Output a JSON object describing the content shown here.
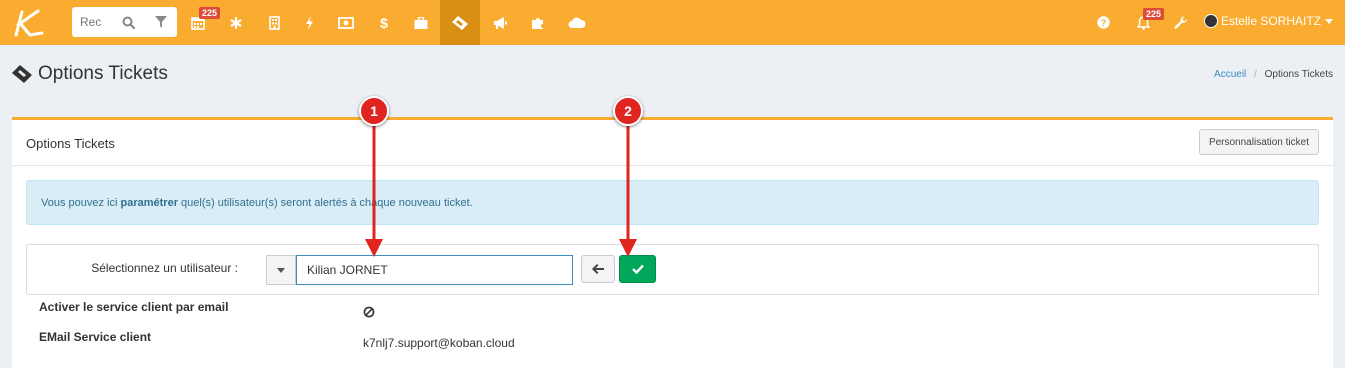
{
  "topbar": {
    "search_placeholder": "Rec",
    "calendar_badge": "225",
    "notif_badge": "225",
    "user_name": "Estelle SORHAITZ",
    "icons": [
      "calendar-icon",
      "asterisk-icon",
      "building-icon",
      "bolt-icon",
      "money-icon",
      "dollar-icon",
      "briefcase-icon",
      "ticket-icon",
      "bullhorn-icon",
      "puzzle-icon",
      "cloud-icon",
      "help-icon",
      "bell-icon",
      "wrench-icon"
    ],
    "accent": "#f9ac2f"
  },
  "page": {
    "title": "Options Tickets",
    "breadcrumb": [
      "Accueil",
      "Options Tickets"
    ]
  },
  "box": {
    "title": "Options Tickets",
    "customize_button": "Personnalisation ticket",
    "alert_prefix": "Vous pouvez ici ",
    "alert_bold": "paramétrer",
    "alert_suffix": " quel(s) utilisateur(s) seront alertés à chaque nouveau ticket.",
    "select_label": "Sélectionnez un utilisateur :",
    "selected_user": "Kilian JORNET",
    "email_service_label": "Activer le service client par email",
    "email_label": "EMail Service client",
    "email_value": "k7nlj7.support@koban.cloud"
  },
  "annotations": {
    "marker_1": "1",
    "marker_2": "2",
    "color": "#e02420"
  }
}
